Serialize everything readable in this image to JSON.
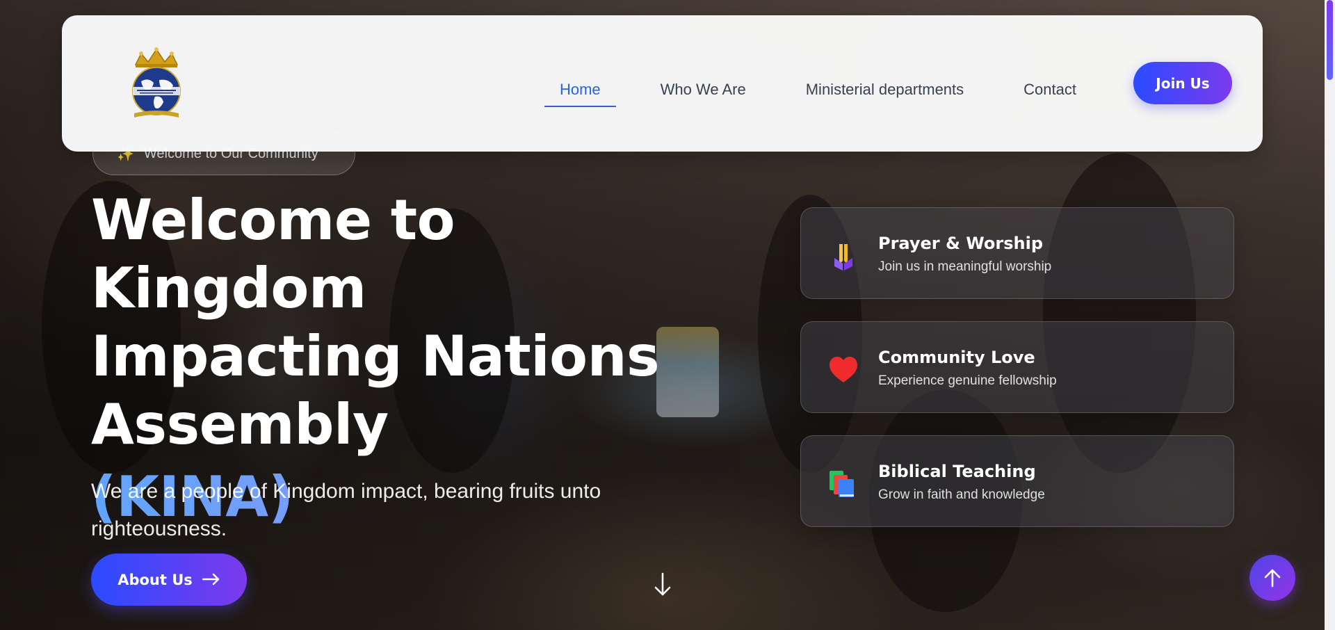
{
  "nav": {
    "logo_alt": "Kingdom Impacting Nations Ministries logo",
    "links": [
      {
        "label": "Home",
        "active": true
      },
      {
        "label": "Who We Are",
        "active": false
      },
      {
        "label": "Ministerial departments",
        "active": false
      },
      {
        "label": "Contact",
        "active": false
      }
    ],
    "join_label": "Join Us"
  },
  "hero": {
    "badge_icon": "sparkles-icon",
    "badge_text": "Welcome to Our Community",
    "title_line1": "Welcome to Kingdom",
    "title_line2": "Impacting Nations",
    "title_line3": "Assembly",
    "title_accent": "(KINA)",
    "subtitle": "We are a people of Kingdom impact, bearing fruits unto righteousness.",
    "cta_label": "About Us",
    "cta_icon": "arrow-right-icon",
    "scroll_icon": "arrow-down-icon"
  },
  "features": [
    {
      "icon": "praying-hands-icon",
      "title": "Prayer & Worship",
      "desc": "Join us in meaningful worship"
    },
    {
      "icon": "heart-icon",
      "title": "Community Love",
      "desc": "Experience genuine fellowship"
    },
    {
      "icon": "books-icon",
      "title": "Biblical Teaching",
      "desc": "Grow in faith and knowledge"
    }
  ],
  "back_to_top_icon": "arrow-up-icon",
  "colors": {
    "brand_gradient_start": "#2b4bff",
    "brand_gradient_end": "#7c3aed",
    "nav_active": "#2563eb",
    "accent_text_start": "#60a5fa",
    "accent_text_end": "#a78bfa"
  }
}
